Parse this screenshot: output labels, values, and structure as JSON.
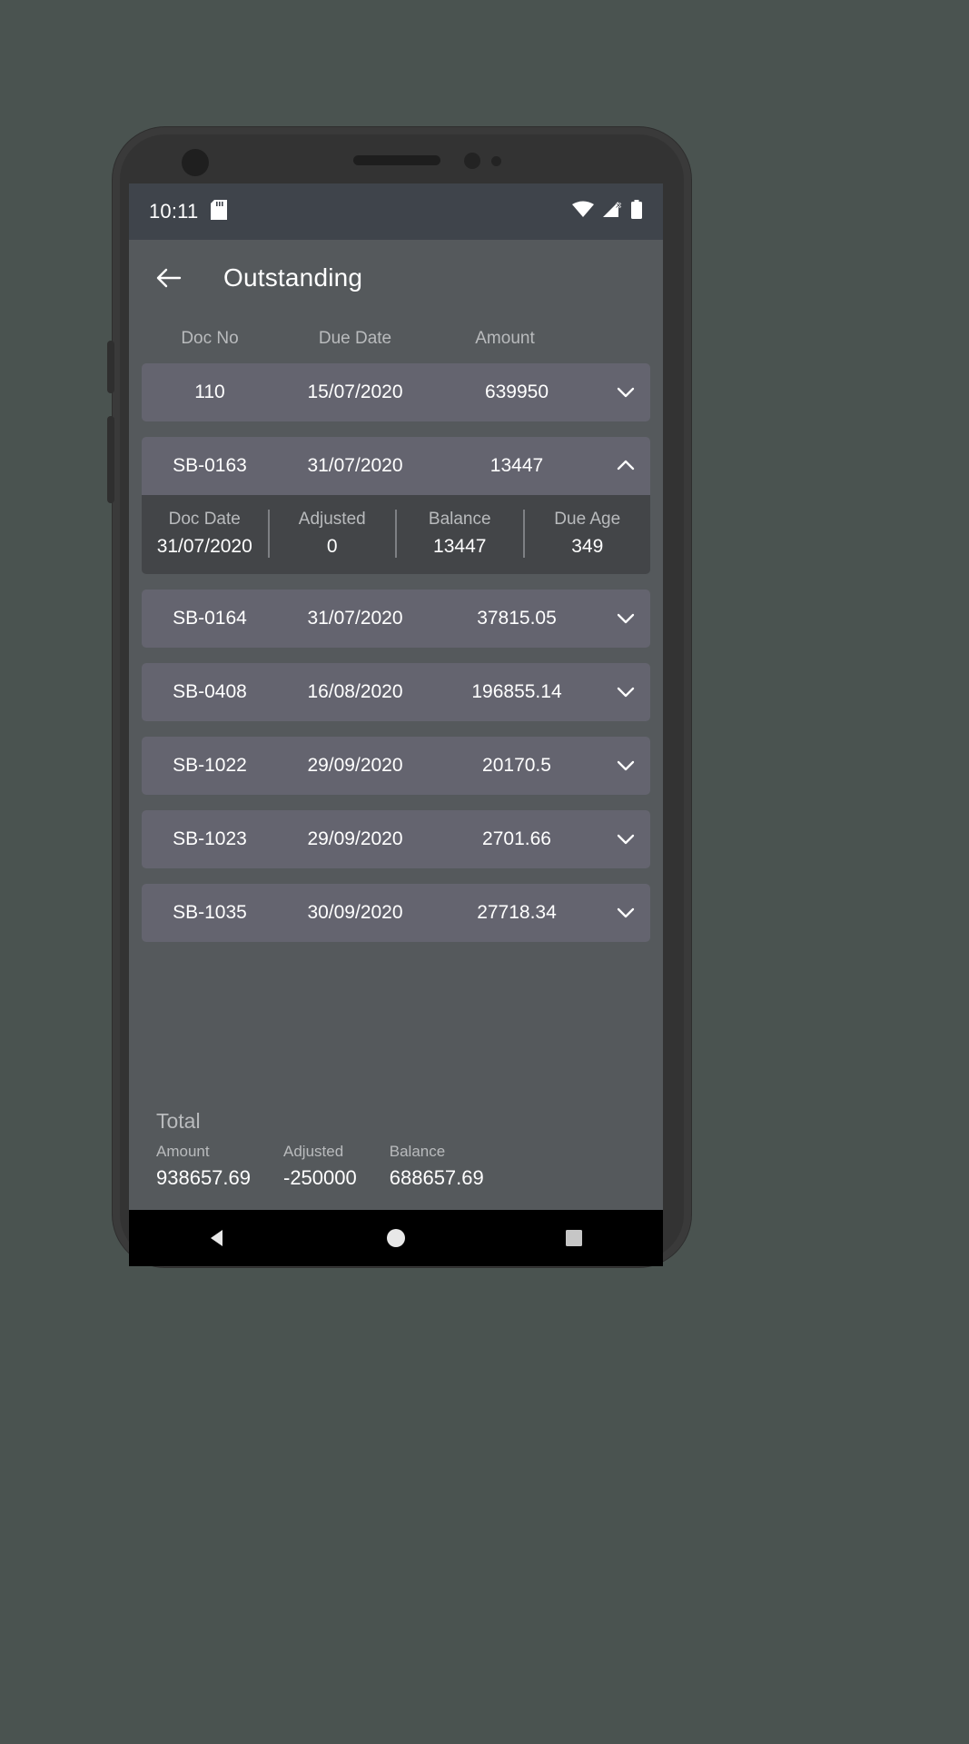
{
  "statusbar": {
    "time": "10:11",
    "icons": [
      "sd-card-icon",
      "wifi-icon",
      "cell-signal-icon",
      "battery-icon"
    ]
  },
  "appbar": {
    "back_icon": "back-arrow-icon",
    "title": "Outstanding"
  },
  "table": {
    "columns": {
      "doc_no": "Doc No",
      "due_date": "Due Date",
      "amount": "Amount"
    },
    "rows": [
      {
        "doc_no": "110",
        "due_date": "15/07/2020",
        "amount": "639950",
        "expanded": false,
        "chevron": "chevron-down-icon"
      },
      {
        "doc_no": "SB-0163",
        "due_date": "31/07/2020",
        "amount": "13447",
        "expanded": true,
        "chevron": "chevron-up-icon"
      },
      {
        "doc_no": "SB-0164",
        "due_date": "31/07/2020",
        "amount": "37815.05",
        "expanded": false,
        "chevron": "chevron-down-icon"
      },
      {
        "doc_no": "SB-0408",
        "due_date": "16/08/2020",
        "amount": "196855.14",
        "expanded": false,
        "chevron": "chevron-down-icon"
      },
      {
        "doc_no": "SB-1022",
        "due_date": "29/09/2020",
        "amount": "20170.5",
        "expanded": false,
        "chevron": "chevron-down-icon"
      },
      {
        "doc_no": "SB-1023",
        "due_date": "29/09/2020",
        "amount": "2701.66",
        "expanded": false,
        "chevron": "chevron-down-icon"
      },
      {
        "doc_no": "SB-1035",
        "due_date": "30/09/2020",
        "amount": "27718.34",
        "expanded": false,
        "chevron": "chevron-down-icon"
      }
    ],
    "expanded_detail": {
      "doc_date_label": "Doc Date",
      "doc_date_value": "31/07/2020",
      "adjusted_label": "Adjusted",
      "adjusted_value": "0",
      "balance_label": "Balance",
      "balance_value": "13447",
      "due_age_label": "Due Age",
      "due_age_value": "349"
    }
  },
  "totals": {
    "title": "Total",
    "amount_label": "Amount",
    "amount_value": "938657.69",
    "adjusted_label": "Adjusted",
    "adjusted_value": "-250000",
    "balance_label": "Balance",
    "balance_value": "688657.69"
  },
  "navbar": {
    "back": "nav-back-icon",
    "home": "nav-home-icon",
    "recents": "nav-recents-icon"
  },
  "colors": {
    "desktop_bg": "#4a5350",
    "screen_bg": "#55595c",
    "statusbar_bg": "#3f444b",
    "row_bg": "#64646f",
    "detail_bg": "#434548",
    "text_primary": "#ffffff",
    "text_secondary": "#b9bbbd"
  }
}
